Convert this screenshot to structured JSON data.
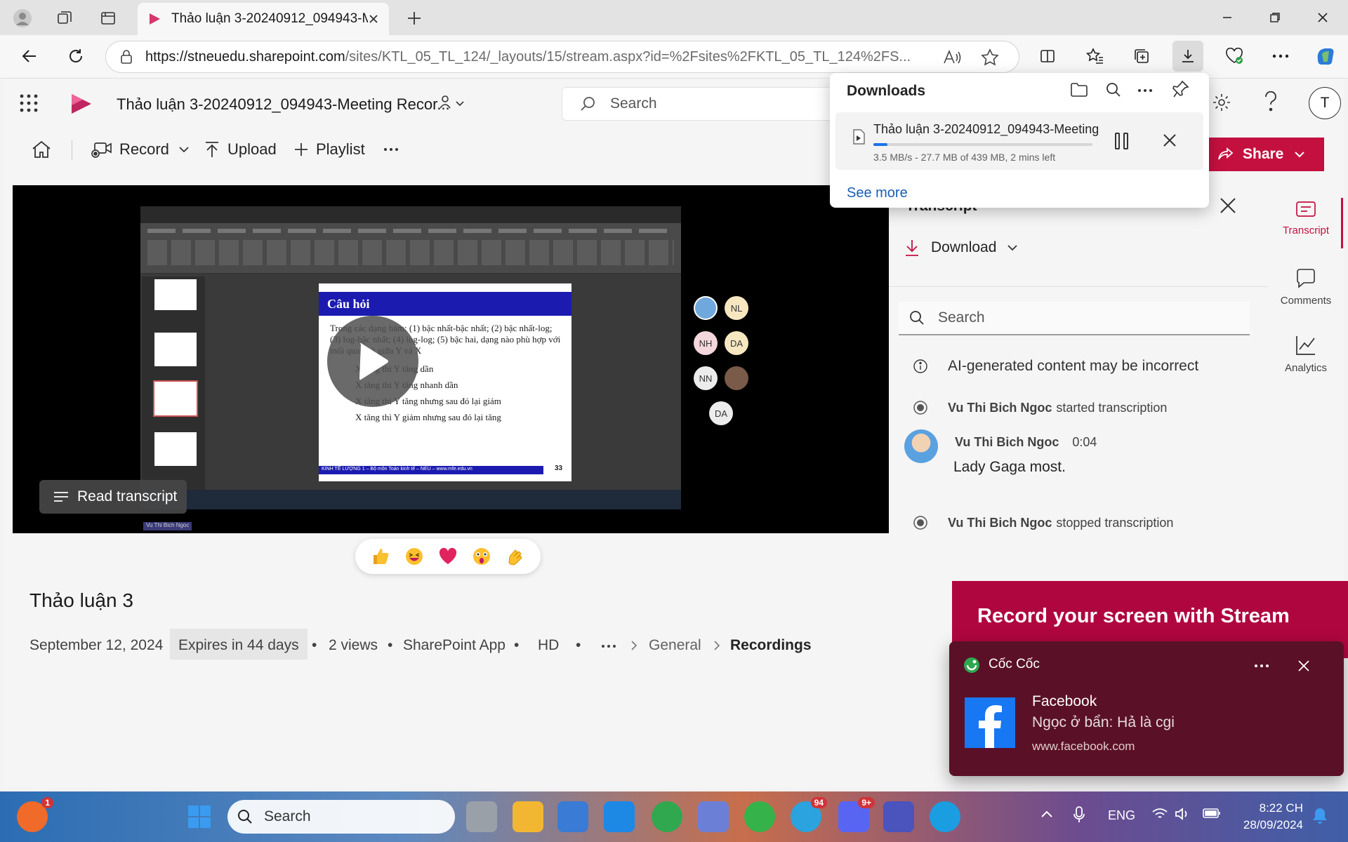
{
  "browser": {
    "tab_title": "Thảo luận 3-20240912_094943-M",
    "url_host": "https://stneuedu.sharepoint.com",
    "url_path": "/sites/KTL_05_TL_124/_layouts/15/stream.aspx?id=%2Fsites%2FKTL_05_TL_124%2FS..."
  },
  "app": {
    "title": "Thảo luận 3-20240912_094943-Meeting Recor...",
    "search_placeholder": "Search",
    "avatar_initial": "T",
    "share_label": "Share",
    "commands": {
      "record": "Record",
      "upload": "Upload",
      "playlist": "Playlist"
    }
  },
  "downloads": {
    "header": "Downloads",
    "file_name": "Thảo luận 3-20240912_094943-Meeting",
    "status": "3.5 MB/s - 27.7 MB of 439 MB, 2 mins left",
    "progress_fraction": 0.063,
    "see_more": "See more"
  },
  "video": {
    "slide_title": "Câu hỏi",
    "slide_intro": "Trong các dạng hàm: (1) bậc nhất-bậc nhất; (2) bậc nhất-log; (3) log-bậc nhất; (4) log-log; (5) bậc hai, dạng nào phù hợp với mối quan hệ giữa Y và X",
    "slide_bullets": [
      "X tăng thì Y tăng dần",
      "X tăng thì Y tăng nhanh dần",
      "X tăng thì Y tăng nhưng sau đó lại giảm",
      "X tăng thì Y giảm nhưng sau đó lại tăng"
    ],
    "slide_footer": "KINH TẾ LƯỢNG 1 – Bộ môn Toán kinh tế – NEU – www.mfe.edu.vn",
    "slide_number": "33",
    "participants": [
      "NL",
      "NH",
      "DA",
      "NN",
      "DA"
    ],
    "presenter_label": "Vu Thi Bich Ngoc",
    "read_transcript": "Read transcript"
  },
  "recording": {
    "title": "Thảo luận 3",
    "date": "September 12, 2024",
    "expires": "Expires in 44 days",
    "views": "2 views",
    "source": "SharePoint App",
    "quality": "HD",
    "crumb1": "General",
    "crumb2": "Recordings"
  },
  "transcript": {
    "title": "Transcript",
    "download": "Download",
    "search_placeholder": "Search",
    "ai_notice": "AI-generated content may be incorrect",
    "events": [
      {
        "name": "Vu Thi Bich Ngoc",
        "text": "started transcription"
      },
      {
        "name": "Vu Thi Bich Ngoc",
        "text": "stopped transcription"
      }
    ],
    "entry": {
      "name": "Vu Thi Bich Ngoc",
      "time": "0:04",
      "text": "Lady Gaga most."
    }
  },
  "rail": {
    "transcript": "Transcript",
    "comments": "Comments",
    "analytics": "Analytics"
  },
  "promo": {
    "text": "Record your screen with Stream"
  },
  "toast": {
    "app": "Cốc Cốc",
    "title": "Facebook",
    "message": "Ngọc ở bẩn: Hả là cgi",
    "site": "www.facebook.com"
  },
  "taskbar": {
    "search": "Search",
    "lang": "ENG",
    "time": "8:22 CH",
    "date": "28/09/2024",
    "badge_start": "1",
    "badge_telegram": "94",
    "badge_discord": "9+"
  },
  "colors": {
    "accent": "#c4103f",
    "toast_bg": "#5a1128",
    "promo_bg": "#b0063f"
  }
}
